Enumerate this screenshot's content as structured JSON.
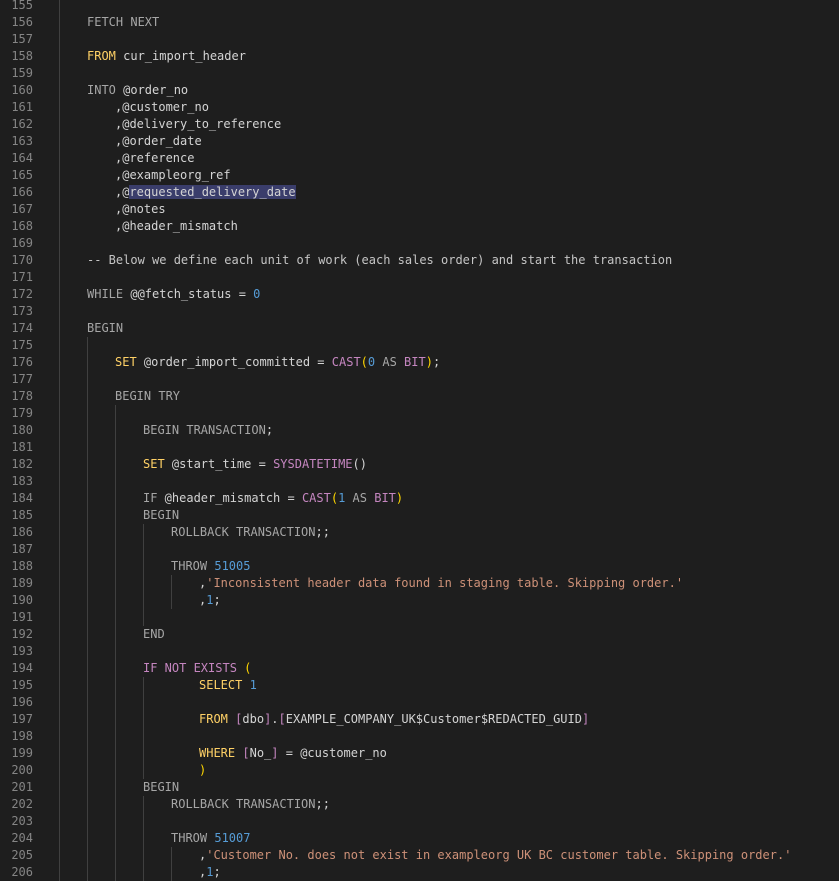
{
  "editor": {
    "lines": [
      {
        "n": "155",
        "indent": 0,
        "guides": [],
        "tokens": []
      },
      {
        "n": "156",
        "indent": 1,
        "guides": [],
        "tokens": [
          {
            "t": "FETCH NEXT",
            "c": "kw2"
          }
        ]
      },
      {
        "n": "157",
        "indent": 0,
        "guides": [],
        "tokens": []
      },
      {
        "n": "158",
        "indent": 1,
        "guides": [],
        "tokens": [
          {
            "t": "FROM",
            "c": "kw"
          },
          {
            "t": " cur_import_header",
            "c": "plain"
          }
        ]
      },
      {
        "n": "159",
        "indent": 0,
        "guides": [],
        "tokens": []
      },
      {
        "n": "160",
        "indent": 1,
        "guides": [],
        "tokens": [
          {
            "t": "INTO",
            "c": "kw2"
          },
          {
            "t": " @order_no",
            "c": "plain"
          }
        ]
      },
      {
        "n": "161",
        "indent": 2,
        "guides": [],
        "tokens": [
          {
            "t": ",@customer_no",
            "c": "plain"
          }
        ]
      },
      {
        "n": "162",
        "indent": 2,
        "guides": [],
        "tokens": [
          {
            "t": ",@delivery_to_reference",
            "c": "plain"
          }
        ]
      },
      {
        "n": "163",
        "indent": 2,
        "guides": [],
        "tokens": [
          {
            "t": ",@order_date",
            "c": "plain"
          }
        ]
      },
      {
        "n": "164",
        "indent": 2,
        "guides": [],
        "tokens": [
          {
            "t": ",@reference",
            "c": "plain"
          }
        ]
      },
      {
        "n": "165",
        "indent": 2,
        "guides": [],
        "tokens": [
          {
            "t": ",@exampleorg_ref",
            "c": "plain"
          }
        ]
      },
      {
        "n": "166",
        "indent": 2,
        "guides": [],
        "tokens": [
          {
            "t": ",@",
            "c": "plain"
          },
          {
            "t": "requested_delivery_date",
            "c": "sel"
          }
        ]
      },
      {
        "n": "167",
        "indent": 2,
        "guides": [],
        "tokens": [
          {
            "t": ",@notes",
            "c": "plain"
          }
        ]
      },
      {
        "n": "168",
        "indent": 2,
        "guides": [],
        "tokens": [
          {
            "t": ",@header_mismatch",
            "c": "plain"
          }
        ]
      },
      {
        "n": "169",
        "indent": 0,
        "guides": [],
        "tokens": []
      },
      {
        "n": "170",
        "indent": 1,
        "guides": [],
        "tokens": [
          {
            "t": "-- Below we define each unit of work (each sales order) and start the transaction",
            "c": "com"
          }
        ]
      },
      {
        "n": "171",
        "indent": 0,
        "guides": [],
        "tokens": []
      },
      {
        "n": "172",
        "indent": 1,
        "guides": [],
        "tokens": [
          {
            "t": "WHILE",
            "c": "kw2"
          },
          {
            "t": " @@fetch_status = ",
            "c": "plain"
          },
          {
            "t": "0",
            "c": "num"
          }
        ]
      },
      {
        "n": "173",
        "indent": 0,
        "guides": [],
        "tokens": []
      },
      {
        "n": "174",
        "indent": 1,
        "guides": [],
        "tokens": [
          {
            "t": "BEGIN",
            "c": "kw2"
          }
        ]
      },
      {
        "n": "175",
        "indent": 0,
        "guides": [
          1
        ],
        "tokens": []
      },
      {
        "n": "176",
        "indent": 2,
        "guides": [
          1
        ],
        "tokens": [
          {
            "t": "SET",
            "c": "kw"
          },
          {
            "t": " @order_import_committed = ",
            "c": "plain"
          },
          {
            "t": "CAST",
            "c": "fn"
          },
          {
            "t": "(",
            "c": "paren"
          },
          {
            "t": "0",
            "c": "num"
          },
          {
            "t": " AS ",
            "c": "kw2"
          },
          {
            "t": "BIT",
            "c": "fn"
          },
          {
            "t": ")",
            "c": "paren"
          },
          {
            "t": ";",
            "c": "plain"
          }
        ]
      },
      {
        "n": "177",
        "indent": 0,
        "guides": [
          1
        ],
        "tokens": []
      },
      {
        "n": "178",
        "indent": 2,
        "guides": [
          1
        ],
        "tokens": [
          {
            "t": "BEGIN TRY",
            "c": "kw2"
          }
        ]
      },
      {
        "n": "179",
        "indent": 0,
        "guides": [
          1,
          2
        ],
        "tokens": []
      },
      {
        "n": "180",
        "indent": 3,
        "guides": [
          1,
          2
        ],
        "tokens": [
          {
            "t": "BEGIN TRANSACTION",
            "c": "kw2"
          },
          {
            "t": ";",
            "c": "plain"
          }
        ]
      },
      {
        "n": "181",
        "indent": 0,
        "guides": [
          1,
          2
        ],
        "tokens": []
      },
      {
        "n": "182",
        "indent": 3,
        "guides": [
          1,
          2
        ],
        "tokens": [
          {
            "t": "SET",
            "c": "kw"
          },
          {
            "t": " @start_time = ",
            "c": "plain"
          },
          {
            "t": "SYSDATETIME",
            "c": "fn"
          },
          {
            "t": "()",
            "c": "plain"
          }
        ]
      },
      {
        "n": "183",
        "indent": 0,
        "guides": [
          1,
          2
        ],
        "tokens": []
      },
      {
        "n": "184",
        "indent": 3,
        "guides": [
          1,
          2
        ],
        "tokens": [
          {
            "t": "IF",
            "c": "kw2"
          },
          {
            "t": " @header_mismatch = ",
            "c": "plain"
          },
          {
            "t": "CAST",
            "c": "fn"
          },
          {
            "t": "(",
            "c": "paren"
          },
          {
            "t": "1",
            "c": "num"
          },
          {
            "t": " AS ",
            "c": "kw2"
          },
          {
            "t": "BIT",
            "c": "fn"
          },
          {
            "t": ")",
            "c": "paren"
          }
        ]
      },
      {
        "n": "185",
        "indent": 3,
        "guides": [
          1,
          2
        ],
        "tokens": [
          {
            "t": "BEGIN",
            "c": "kw2"
          }
        ]
      },
      {
        "n": "186",
        "indent": 4,
        "guides": [
          1,
          2,
          3
        ],
        "tokens": [
          {
            "t": "ROLLBACK TRANSACTION",
            "c": "kw2"
          },
          {
            "t": ";;",
            "c": "plain"
          }
        ]
      },
      {
        "n": "187",
        "indent": 0,
        "guides": [
          1,
          2,
          3
        ],
        "tokens": []
      },
      {
        "n": "188",
        "indent": 4,
        "guides": [
          1,
          2,
          3
        ],
        "tokens": [
          {
            "t": "THROW",
            "c": "kw2"
          },
          {
            "t": " ",
            "c": "plain"
          },
          {
            "t": "51005",
            "c": "num"
          }
        ]
      },
      {
        "n": "189",
        "indent": 5,
        "guides": [
          1,
          2,
          3,
          4
        ],
        "tokens": [
          {
            "t": ",",
            "c": "plain"
          },
          {
            "t": "'Inconsistent header data found in staging table. Skipping order.'",
            "c": "str"
          }
        ]
      },
      {
        "n": "190",
        "indent": 5,
        "guides": [
          1,
          2,
          3,
          4
        ],
        "tokens": [
          {
            "t": ",",
            "c": "plain"
          },
          {
            "t": "1",
            "c": "num"
          },
          {
            "t": ";",
            "c": "plain"
          }
        ]
      },
      {
        "n": "191",
        "indent": 0,
        "guides": [
          1,
          2,
          3
        ],
        "tokens": []
      },
      {
        "n": "192",
        "indent": 3,
        "guides": [
          1,
          2
        ],
        "tokens": [
          {
            "t": "END",
            "c": "kw2"
          }
        ]
      },
      {
        "n": "193",
        "indent": 0,
        "guides": [
          1,
          2
        ],
        "tokens": []
      },
      {
        "n": "194",
        "indent": 3,
        "guides": [
          1,
          2
        ],
        "tokens": [
          {
            "t": "IF NOT EXISTS",
            "c": "kw3"
          },
          {
            "t": " ",
            "c": "plain"
          },
          {
            "t": "(",
            "c": "paren"
          }
        ]
      },
      {
        "n": "195",
        "indent": 5,
        "guides": [
          1,
          2,
          3
        ],
        "tokens": [
          {
            "t": "SELECT",
            "c": "kw"
          },
          {
            "t": " ",
            "c": "plain"
          },
          {
            "t": "1",
            "c": "num"
          }
        ]
      },
      {
        "n": "196",
        "indent": 0,
        "guides": [
          1,
          2,
          3
        ],
        "tokens": []
      },
      {
        "n": "197",
        "indent": 5,
        "guides": [
          1,
          2,
          3
        ],
        "tokens": [
          {
            "t": "FROM",
            "c": "kw"
          },
          {
            "t": " ",
            "c": "plain"
          },
          {
            "t": "[",
            "c": "brk"
          },
          {
            "t": "dbo",
            "c": "plain"
          },
          {
            "t": "]",
            "c": "brk"
          },
          {
            "t": ".",
            "c": "plain"
          },
          {
            "t": "[",
            "c": "brk"
          },
          {
            "t": "EXAMPLE_COMPANY_UK$Customer$REDACTED_GUID",
            "c": "plain"
          },
          {
            "t": "]",
            "c": "brk"
          }
        ]
      },
      {
        "n": "198",
        "indent": 0,
        "guides": [
          1,
          2,
          3
        ],
        "tokens": []
      },
      {
        "n": "199",
        "indent": 5,
        "guides": [
          1,
          2,
          3
        ],
        "tokens": [
          {
            "t": "WHERE",
            "c": "kw"
          },
          {
            "t": " ",
            "c": "plain"
          },
          {
            "t": "[",
            "c": "brk"
          },
          {
            "t": "No_",
            "c": "plain"
          },
          {
            "t": "]",
            "c": "brk"
          },
          {
            "t": " = @customer_no",
            "c": "plain"
          }
        ]
      },
      {
        "n": "200",
        "indent": 5,
        "guides": [
          1,
          2,
          3
        ],
        "tokens": [
          {
            "t": ")",
            "c": "paren"
          }
        ]
      },
      {
        "n": "201",
        "indent": 3,
        "guides": [
          1,
          2
        ],
        "tokens": [
          {
            "t": "BEGIN",
            "c": "kw2"
          }
        ]
      },
      {
        "n": "202",
        "indent": 4,
        "guides": [
          1,
          2,
          3
        ],
        "tokens": [
          {
            "t": "ROLLBACK TRANSACTION",
            "c": "kw2"
          },
          {
            "t": ";;",
            "c": "plain"
          }
        ]
      },
      {
        "n": "203",
        "indent": 0,
        "guides": [
          1,
          2,
          3
        ],
        "tokens": []
      },
      {
        "n": "204",
        "indent": 4,
        "guides": [
          1,
          2,
          3
        ],
        "tokens": [
          {
            "t": "THROW",
            "c": "kw2"
          },
          {
            "t": " ",
            "c": "plain"
          },
          {
            "t": "51007",
            "c": "num"
          }
        ]
      },
      {
        "n": "205",
        "indent": 5,
        "guides": [
          1,
          2,
          3,
          4
        ],
        "tokens": [
          {
            "t": ",",
            "c": "plain"
          },
          {
            "t": "'Customer No. does not exist in exampleorg UK BC customer table. Skipping order.'",
            "c": "str"
          }
        ]
      },
      {
        "n": "206",
        "indent": 5,
        "guides": [
          1,
          2,
          3,
          4
        ],
        "tokens": [
          {
            "t": ",",
            "c": "plain"
          },
          {
            "t": "1",
            "c": "num"
          },
          {
            "t": ";",
            "c": "plain"
          }
        ]
      }
    ]
  }
}
